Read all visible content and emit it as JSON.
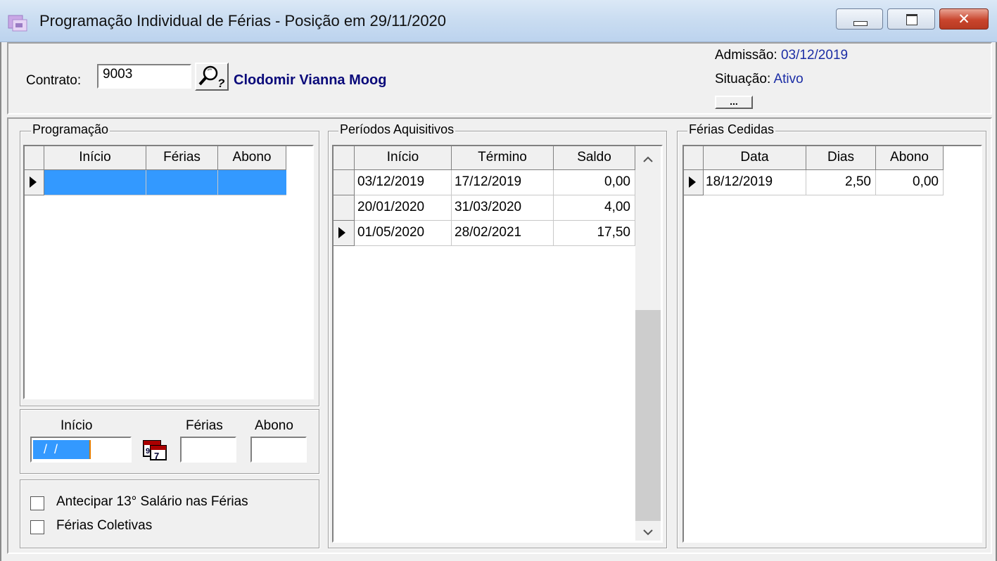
{
  "window": {
    "title": "Programação Individual de Férias - Posição em 29/11/2020",
    "close_glyph": "✕"
  },
  "header": {
    "contrato_label": "Contrato:",
    "contrato_value": "9003",
    "employee_name": "Clodomir Vianna Moog",
    "admissao_label": "Admissão:",
    "admissao_value": "03/12/2019",
    "situacao_label": "Situação:",
    "situacao_value": "Ativo",
    "more_button": "..."
  },
  "programacao": {
    "title": "Programação",
    "columns": [
      "Início",
      "Férias",
      "Abono"
    ],
    "rows": [
      {
        "inicio": "",
        "ferias": "",
        "abono": ""
      }
    ]
  },
  "periodos": {
    "title": "Períodos Aquisitivos",
    "columns": [
      "Início",
      "Término",
      "Saldo"
    ],
    "rows": [
      {
        "inicio": "03/12/2019",
        "termino": "17/12/2019",
        "saldo": "0,00"
      },
      {
        "inicio": "20/01/2020",
        "termino": "31/03/2020",
        "saldo": "4,00"
      },
      {
        "inicio": "01/05/2020",
        "termino": "28/02/2021",
        "saldo": "17,50"
      }
    ]
  },
  "cedidas": {
    "title": "Férias Cedidas",
    "columns": [
      "Data",
      "Dias",
      "Abono"
    ],
    "rows": [
      {
        "data": "18/12/2019",
        "dias": "2,50",
        "abono": "0,00"
      }
    ]
  },
  "edit": {
    "inicio_label": "Início",
    "ferias_label": "Férias",
    "abono_label": "Abono",
    "inicio_value": " /  /",
    "ferias_value": "",
    "abono_value": ""
  },
  "options": {
    "antecipar_label": "Antecipar 13° Salário nas Férias",
    "coletivas_label": "Férias Coletivas"
  },
  "colors": {
    "selection": "#3399ff",
    "name_blue": "#0a0a7a",
    "value_blue": "#1b2da5"
  }
}
